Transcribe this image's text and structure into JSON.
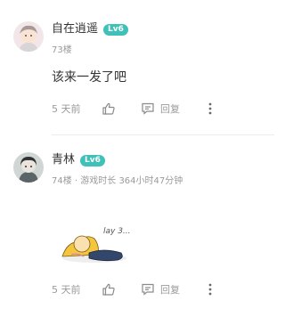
{
  "comments": [
    {
      "username": "自在逍遥",
      "level": "Lv6",
      "meta": "73楼",
      "content": "该来一发了吧",
      "time": "5 天前",
      "reply_label": "回复",
      "icons": {
        "like": "thumbs-up-icon",
        "reply": "comment-icon",
        "more": "more-vertical-icon"
      }
    },
    {
      "username": "青林",
      "level": "Lv6",
      "meta": "74楼 · 游戏时长 364小时47分钟",
      "sticker_text": "lay 3...",
      "time": "5 天前",
      "reply_label": "回复",
      "icons": {
        "like": "thumbs-up-icon",
        "reply": "comment-icon",
        "more": "more-vertical-icon"
      }
    }
  ],
  "colors": {
    "level_badge": "#3fc1b8",
    "meta_text": "#9a9a9a",
    "divider": "#ececec"
  }
}
